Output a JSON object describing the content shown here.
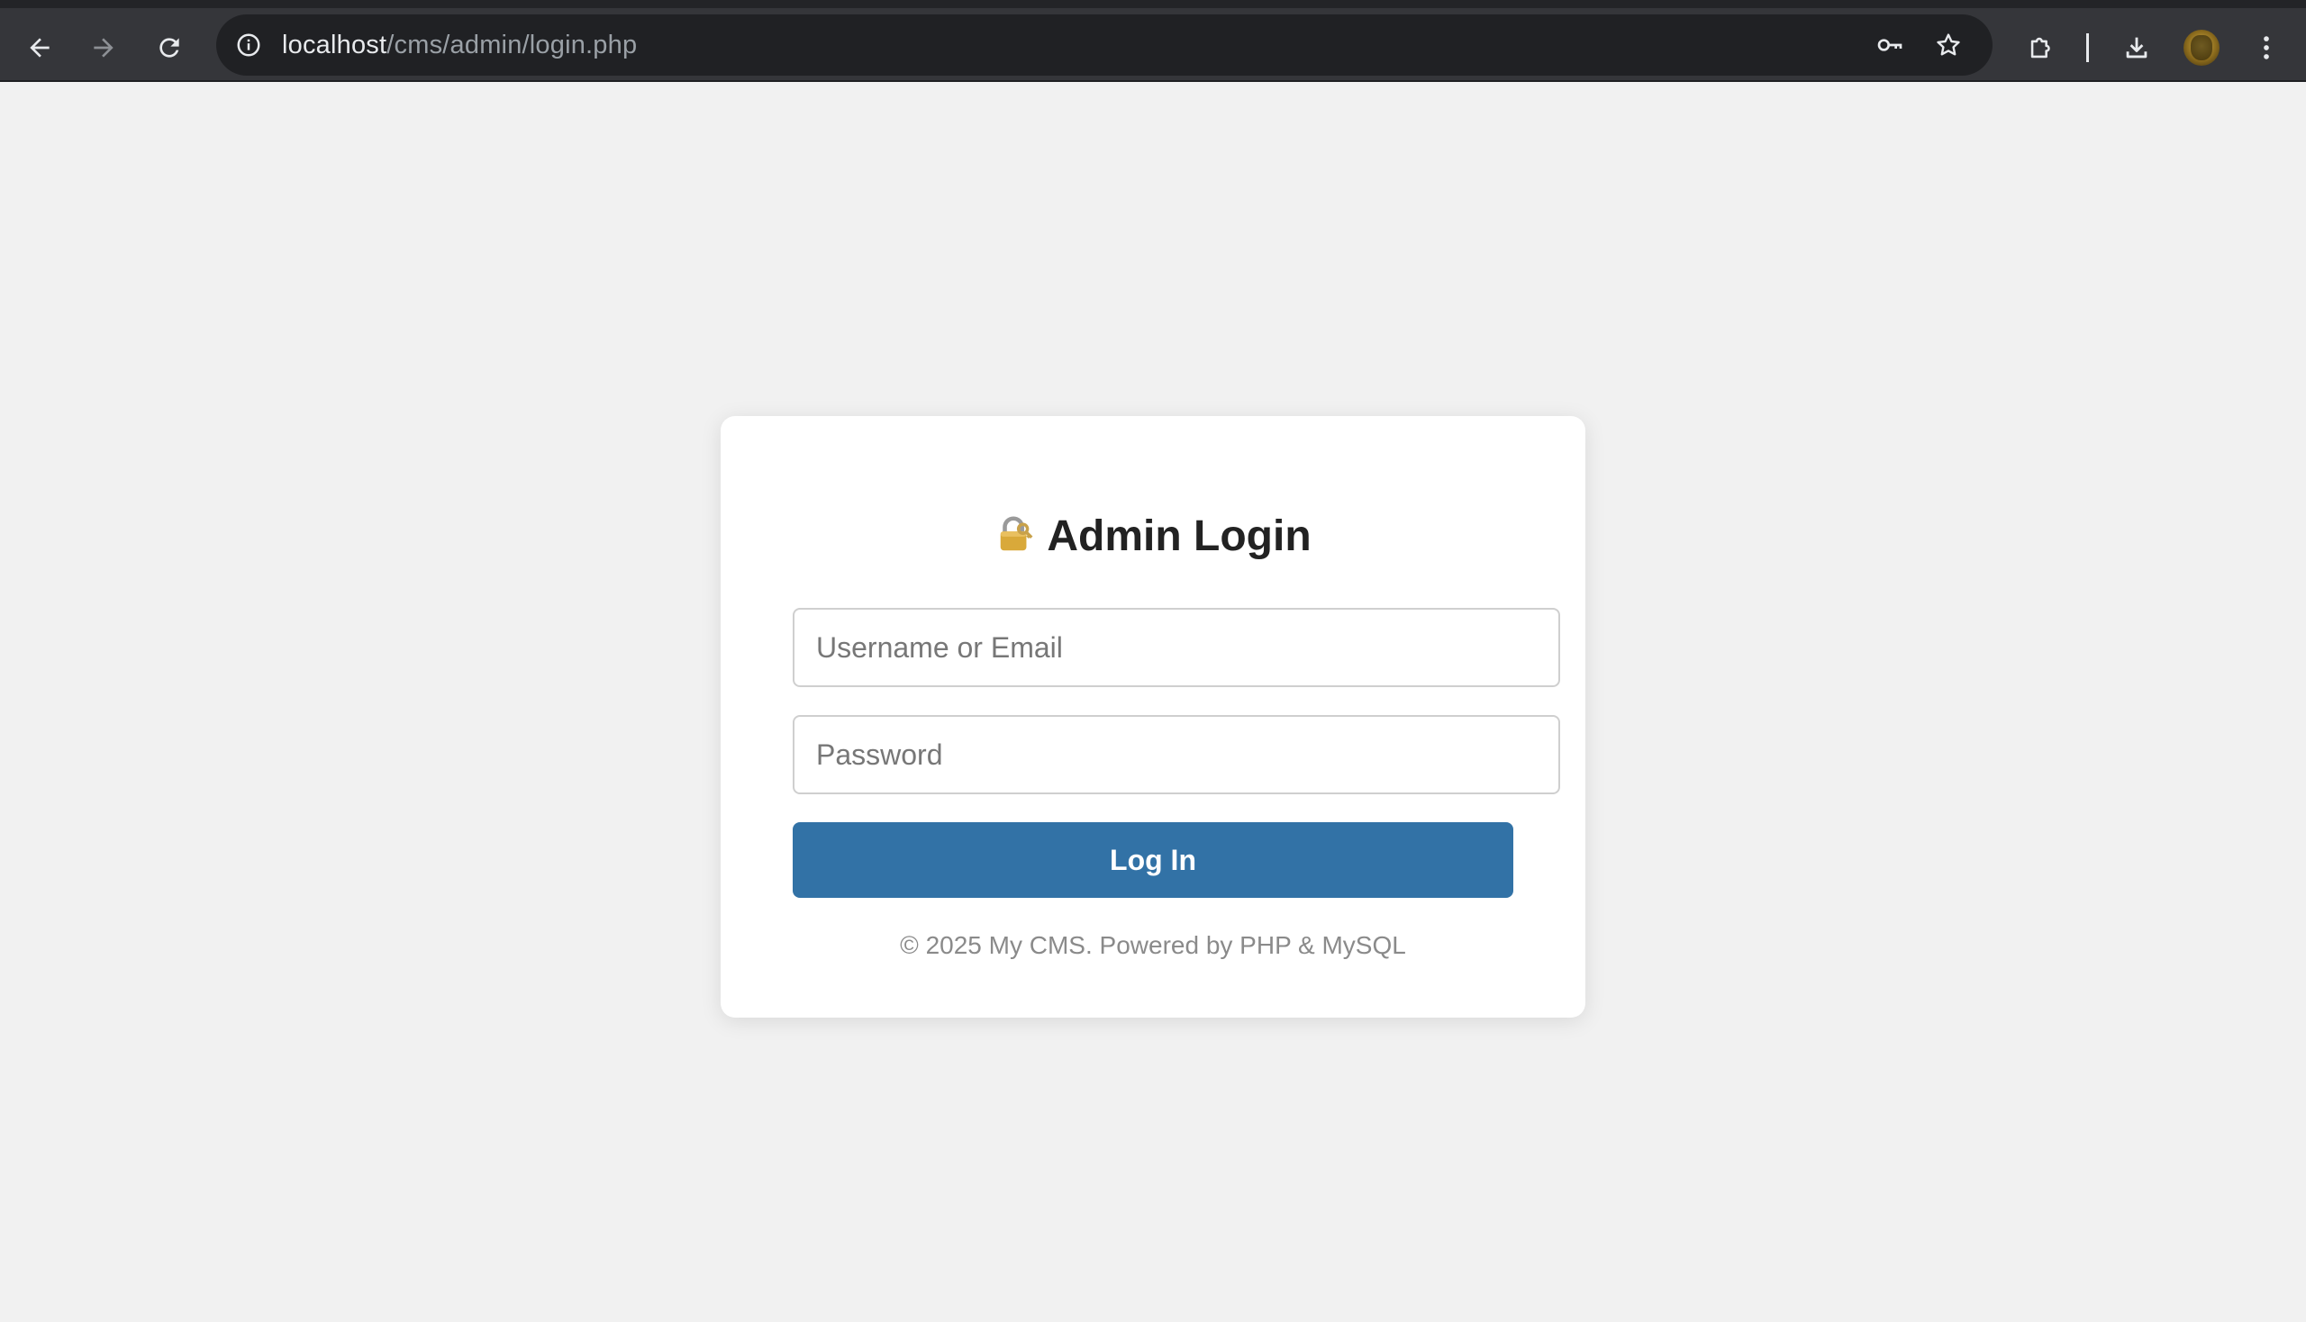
{
  "browser": {
    "url_host": "localhost",
    "url_path": "/cms/admin/login.php",
    "icons": {
      "back": "back-arrow-icon",
      "forward": "forward-arrow-icon",
      "reload": "reload-icon",
      "site_info": "info-icon",
      "password": "key-icon",
      "bookmark": "star-icon",
      "extensions": "puzzle-icon",
      "downloads": "download-icon",
      "profile": "avatar",
      "menu": "kebab-menu-icon"
    },
    "colors": {
      "toolbar": "#35363a",
      "omnibox": "#202124"
    }
  },
  "login": {
    "title_emoji_icon": "locked-with-key-icon",
    "title": "Admin Login",
    "username_placeholder": "Username or Email",
    "username_value": "",
    "password_placeholder": "Password",
    "password_value": "",
    "submit_label": "Log In",
    "footer": "© 2025 My CMS. Powered by PHP & MySQL",
    "colors": {
      "button": "#3272a6",
      "background": "#f1f1f1",
      "card": "#ffffff"
    }
  }
}
